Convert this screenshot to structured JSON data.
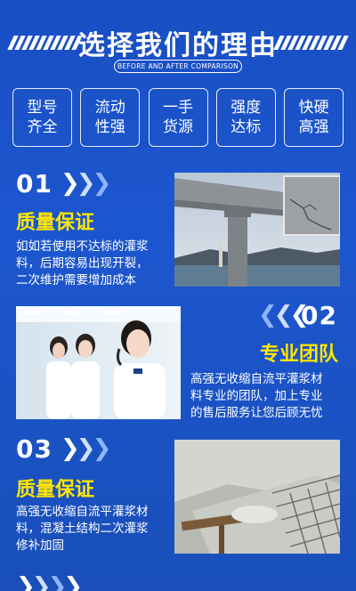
{
  "header": {
    "title": "选择我们的理由",
    "subtitle": "BEFORE AND AFTER COMPARISON"
  },
  "features": [
    {
      "line1": "型号",
      "line2": "齐全"
    },
    {
      "line1": "流动",
      "line2": "性强"
    },
    {
      "line1": "一手",
      "line2": "货源"
    },
    {
      "line1": "强度",
      "line2": "达标"
    },
    {
      "line1": "快硬",
      "line2": "高强"
    }
  ],
  "sections": [
    {
      "number": "01",
      "heading": "质量保证",
      "description": [
        "如如若使用不达标的灌浆",
        "料，后期容易出现开裂，",
        "二次维护需要增加成本"
      ]
    },
    {
      "number": "02",
      "heading": "专业团队",
      "description": [
        "高强无收缩自流平灌浆材",
        "料专业的团队，加上专业",
        "的售后服务让您后顾无忧"
      ]
    },
    {
      "number": "03",
      "heading": "质量保证",
      "description": [
        "高强无收缩自流平灌浆材",
        "料，混凝土结构二次灌浆",
        "修补加固"
      ]
    }
  ],
  "colors": {
    "background": "#1c56cf",
    "heading": "#ffe600",
    "text": "#ffffff"
  },
  "icons": [
    "chevron-right-icon",
    "chevron-left-icon"
  ]
}
